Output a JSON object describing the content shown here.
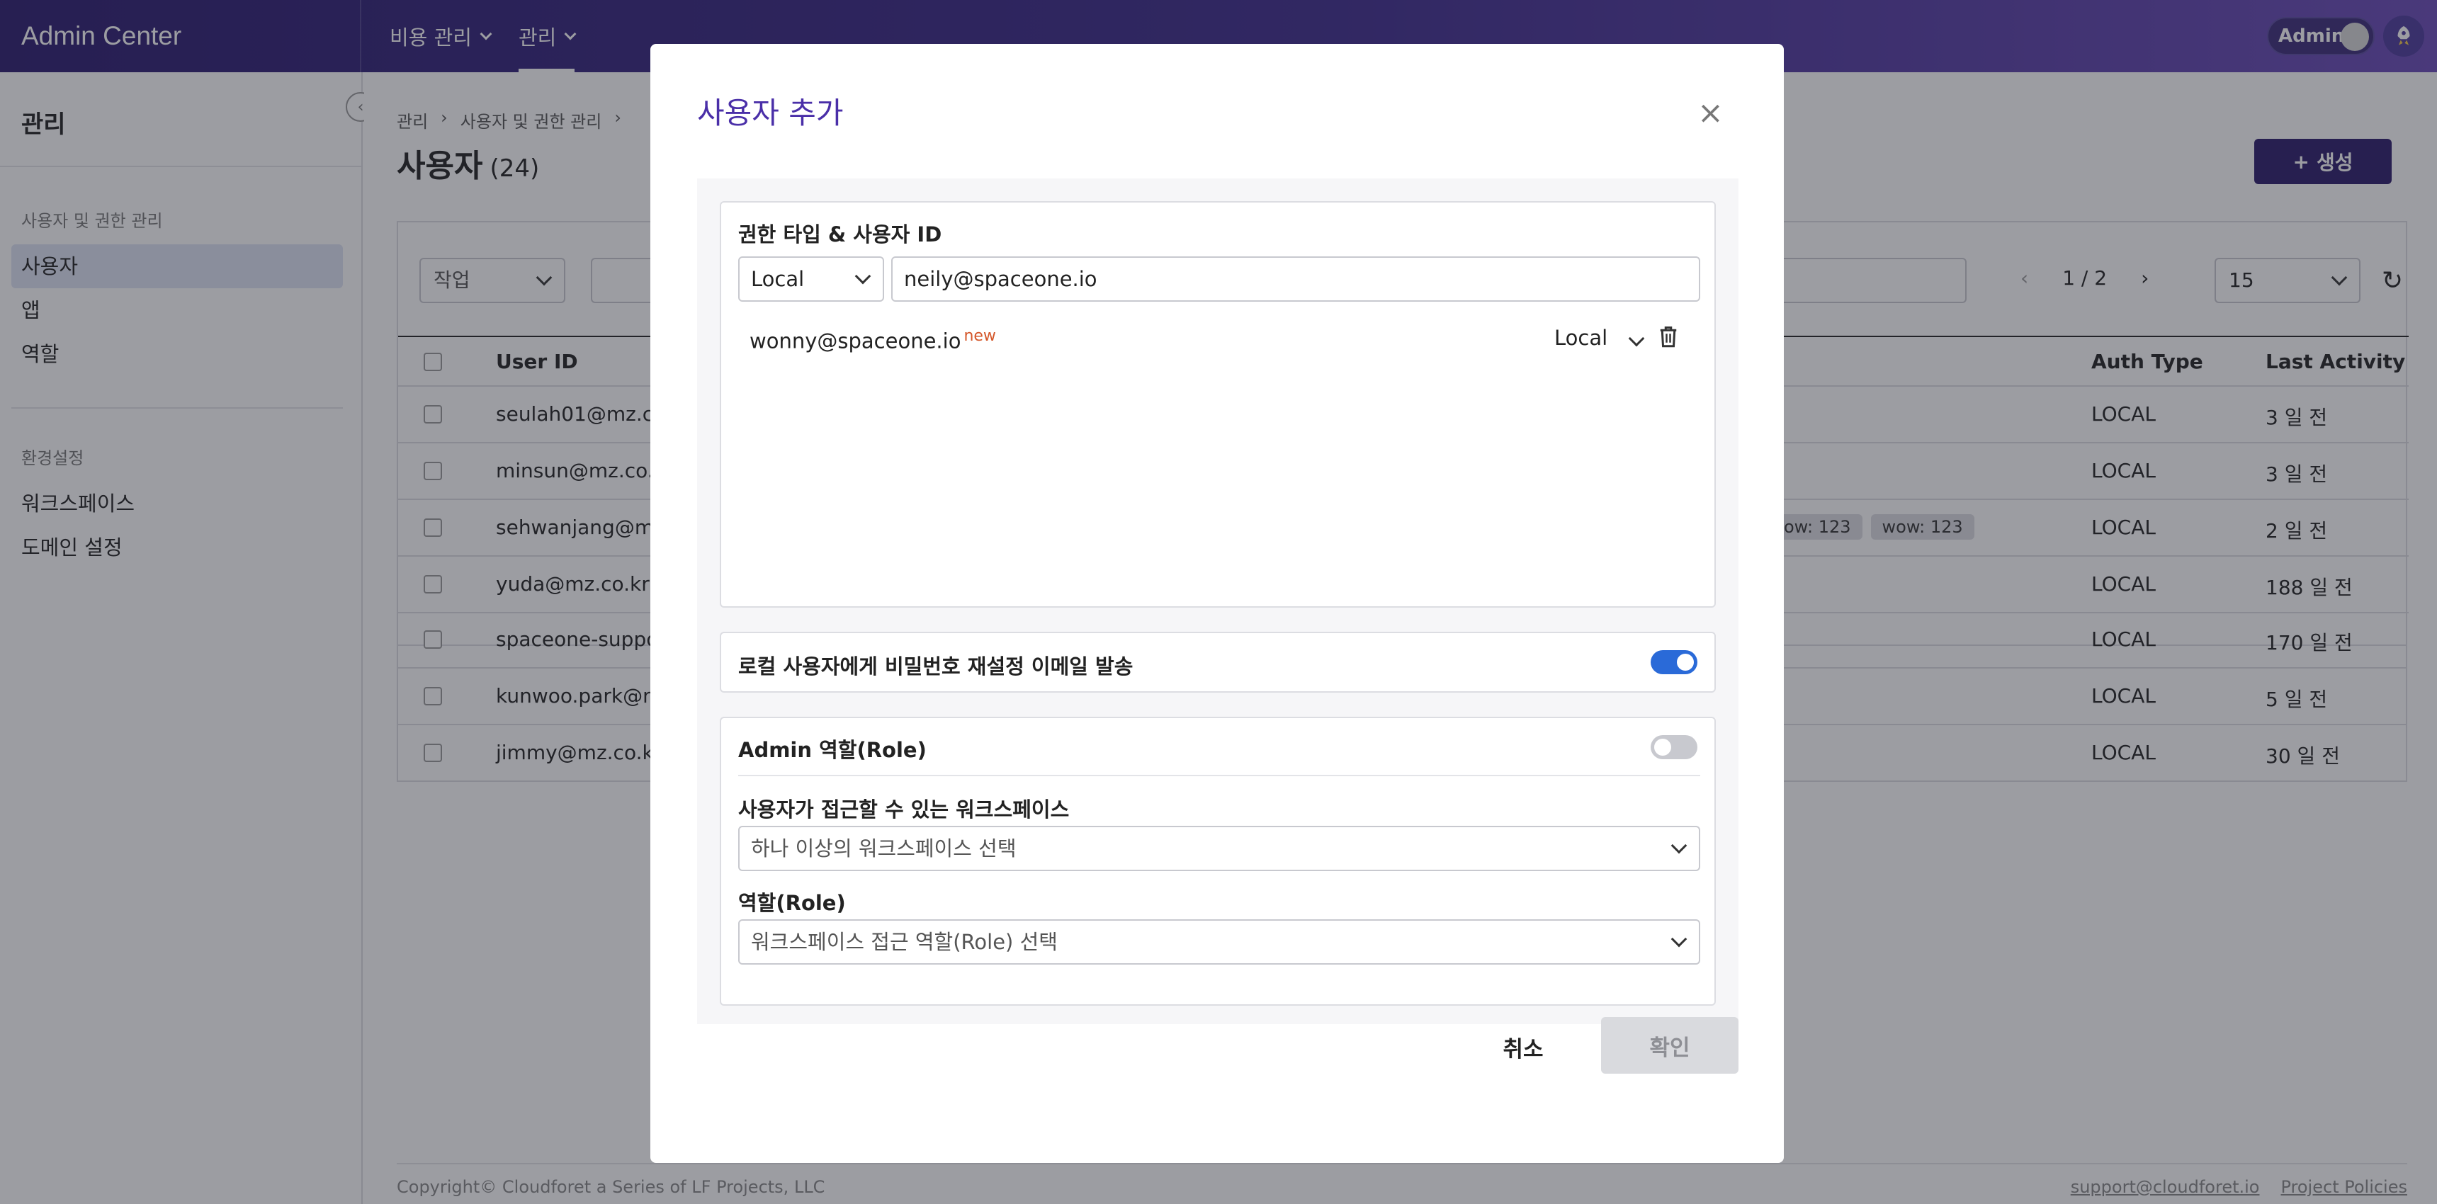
{
  "app": {
    "title": "Admin Center"
  },
  "topnav": {
    "items": [
      {
        "label": "비용 관리"
      },
      {
        "label": "관리"
      }
    ],
    "admin_toggle_label": "Admin"
  },
  "sidebar": {
    "title": "관리",
    "groups": [
      {
        "label": "사용자 및 권한 관리",
        "items": [
          "사용자",
          "앱",
          "역할"
        ]
      },
      {
        "label": "환경설정",
        "items": [
          "워크스페이스",
          "도메인 설정"
        ]
      }
    ],
    "selected": "사용자"
  },
  "breadcrumb": [
    "관리",
    "사용자 및 권한 관리"
  ],
  "page": {
    "title": "사용자",
    "count": "(24)",
    "create_label": "생성"
  },
  "toolbar": {
    "action_select": "작업",
    "pager_text": "1 / 2",
    "page_size": "15"
  },
  "table": {
    "headers": {
      "user_id": "User ID",
      "auth_type": "Auth Type",
      "last_activity": "Last Activity"
    },
    "rows": [
      {
        "user_id": "seulah01@mz.co",
        "auth_type": "LOCAL",
        "last_activity": "3 일 전",
        "tags": []
      },
      {
        "user_id": "minsun@mz.co.k",
        "auth_type": "LOCAL",
        "last_activity": "3 일 전",
        "tags": []
      },
      {
        "user_id": "sehwanjang@mz",
        "auth_type": "LOCAL",
        "last_activity": "2 일 전",
        "tags": [
          "ow: 123",
          "wow: 123"
        ]
      },
      {
        "user_id": "yuda@mz.co.kr",
        "auth_type": "LOCAL",
        "last_activity": "188 일 전",
        "tags": []
      },
      {
        "user_id": "spaceone-suppo",
        "auth_type": "LOCAL",
        "last_activity": "170 일 전",
        "tags": []
      },
      {
        "user_id": "kunwoo.park@m",
        "auth_type": "LOCAL",
        "last_activity": "5 일 전",
        "tags": []
      },
      {
        "user_id": "jimmy@mz.co.kr",
        "auth_type": "LOCAL",
        "last_activity": "30 일 전",
        "tags": []
      }
    ]
  },
  "footer": {
    "copyright": "Copyright© Cloudforet a Series of LF Projects, LLC",
    "support_email": "support@cloudforet.io",
    "policies": "Project Policies"
  },
  "modal": {
    "title": "사용자 추가",
    "auth_section_label": "권한 타입 & 사용자 ID",
    "auth_type_value": "Local",
    "user_id_value": "neily@spaceone.io",
    "added_user": {
      "id": "wonny@spaceone.io",
      "badge": "new",
      "auth_type": "Local"
    },
    "password_reset_label": "로컬 사용자에게 비밀번호 재설정 이메일 발송",
    "password_reset_on": true,
    "admin_role_label": "Admin 역할(Role)",
    "admin_role_on": false,
    "workspace_label": "사용자가 접근할 수 있는 워크스페이스",
    "workspace_placeholder": "하나 이상의 워크스페이스 선택",
    "role_label": "역할(Role)",
    "role_placeholder": "워크스페이스 접근 역할(Role) 선택",
    "cancel_label": "취소",
    "confirm_label": "확인"
  },
  "colors": {
    "brand": "#2b1b6a",
    "modal_title": "#4a2fa8",
    "toggle_on": "#2a6ad8",
    "new_badge": "#d4572a"
  }
}
